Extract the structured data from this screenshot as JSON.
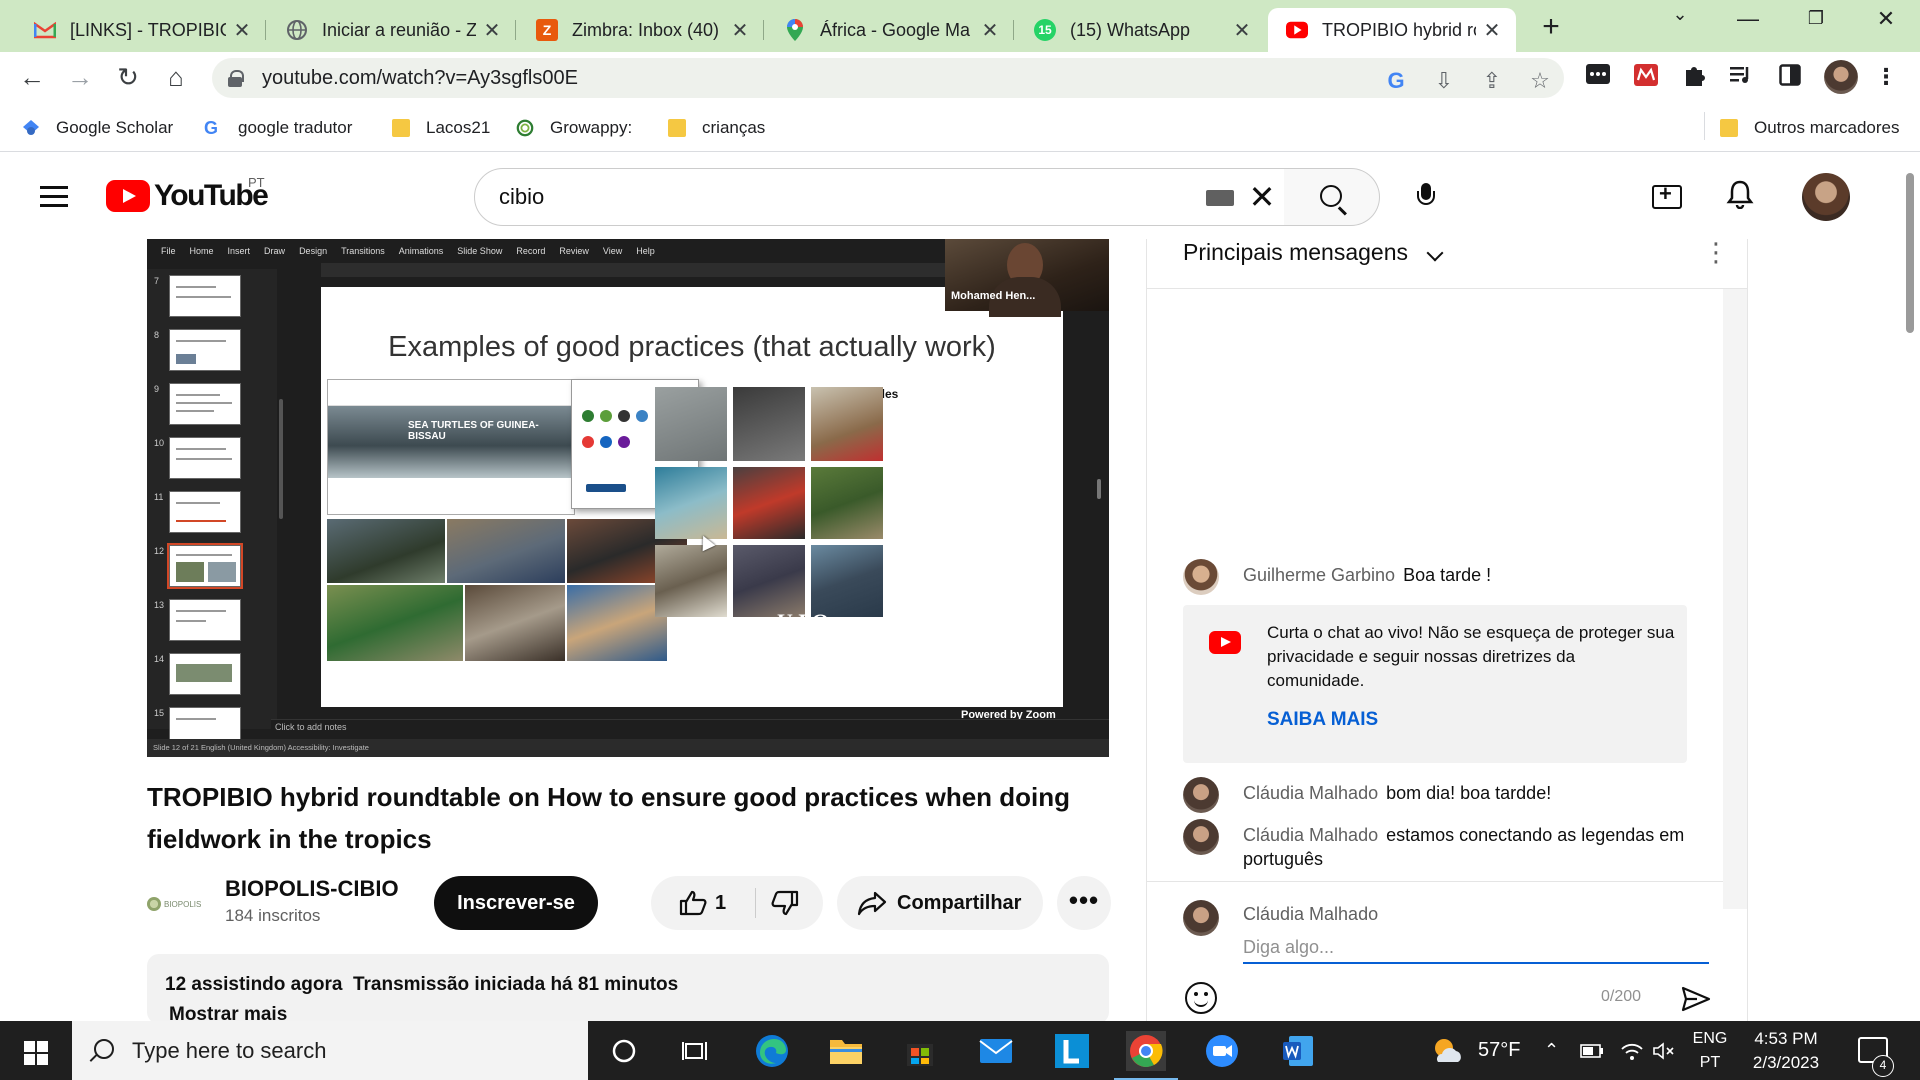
{
  "browser": {
    "tabs": [
      {
        "title": "[LINKS] - TROPIBIO",
        "icon": "gmail-icon",
        "color": "#ea4335",
        "active": false
      },
      {
        "title": "Iniciar a reunião - Z",
        "icon": "globe-icon",
        "color": "#5f6368",
        "active": false
      },
      {
        "title": "Zimbra: Inbox (40)",
        "icon": "zimbra-icon",
        "color": "#e8590c",
        "active": false
      },
      {
        "title": "África - Google Ma",
        "icon": "maps-pin-icon",
        "color": "#34a853",
        "active": false
      },
      {
        "title": "(15) WhatsApp",
        "icon": "whatsapp-icon",
        "color": "#25d366",
        "badge": "15",
        "active": false
      },
      {
        "title": "TROPIBIO hybrid ro",
        "icon": "youtube-icon",
        "color": "#ff0000",
        "active": true
      }
    ],
    "url": "youtube.com/watch?v=Ay3sgfls00E",
    "bookmarks": [
      {
        "label": "Google Scholar",
        "icon": "scholar-icon"
      },
      {
        "label": "google tradutor",
        "icon": "google-icon"
      },
      {
        "label": "Lacos21",
        "icon": "folder-icon"
      },
      {
        "label": "Growappy:",
        "icon": "growappy-icon"
      },
      {
        "label": "crianças",
        "icon": "folder-icon"
      }
    ],
    "other_bookmarks": "Outros marcadores"
  },
  "youtube": {
    "logo_text": "YouTube",
    "country_code": "PT",
    "search_value": "cibio",
    "video": {
      "title": "TROPIBIO hybrid roundtable on How to ensure good practices when doing fieldwork in the tropics",
      "channel_name": "BIOPOLIS-CIBIO",
      "channel_logo_text": "BIOPOLIS",
      "subscribers": "184 inscritos",
      "subscribe_label": "Inscrever-se",
      "like_count": "1",
      "share_label": "Compartilhar",
      "more_label": "•••",
      "watching": "12 assistindo agora",
      "started": "Transmissão iniciada há 81 minutos",
      "show_more": "Mostrar mais"
    },
    "player": {
      "menu": [
        "File",
        "Home",
        "Insert",
        "Draw",
        "Design",
        "Transitions",
        "Animations",
        "Slide Show",
        "Record",
        "Review",
        "View",
        "Help"
      ],
      "thumb_numbers": [
        "7",
        "8",
        "9",
        "10",
        "11",
        "12",
        "13",
        "14",
        "15"
      ],
      "slide_title": "Examples of good practices (that actually work)",
      "sea_turtles_label": "Sea turtles",
      "web_hero_text": "SEA TURTLES OF GUINEA-BISSAU",
      "upo_text": "U.PO",
      "speaker_name": "Mohamed Hen...",
      "notes_text": "Click to add notes",
      "status_text": "Slide 12 of 21    English (United Kingdom)    Accessibility: Investigate",
      "powered_by": "Powered by Zoom"
    },
    "chat": {
      "header": "Principais mensagens",
      "messages": [
        {
          "author": "Guilherme Garbino",
          "text": "Boa tarde !"
        },
        {
          "author": "Cláudia Malhado",
          "text": "bom dia! boa tardde!"
        },
        {
          "author": "Cláudia Malhado",
          "text": "estamos conectando as legendas em português"
        }
      ],
      "notice_text": "Curta o chat ao vivo! Não se esqueça de proteger sua privacidade e seguir nossas diretrizes da comunidade.",
      "notice_link": "SAIBA MAIS",
      "input_author": "Cláudia Malhado",
      "input_placeholder": "Diga algo...",
      "char_count": "0/200"
    }
  },
  "taskbar": {
    "search_placeholder": "Type here to search",
    "weather": "57°F",
    "lang_top": "ENG",
    "lang_bottom": "PT",
    "time": "4:53 PM",
    "date": "2/3/2023",
    "notification_count": "4"
  }
}
